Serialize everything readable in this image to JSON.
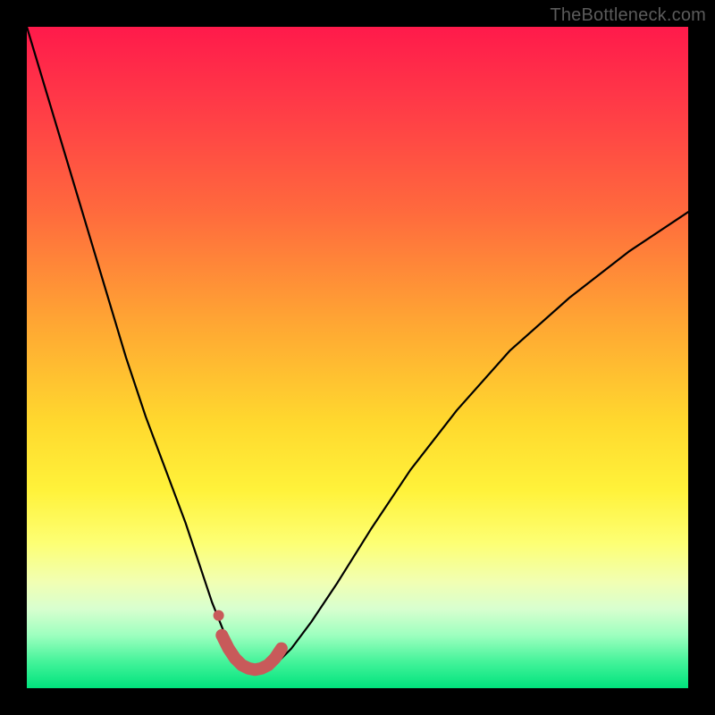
{
  "watermark": "TheBottleneck.com",
  "colors": {
    "frame": "#000000",
    "curve": "#000000",
    "highlight": "#c85a5a",
    "gradient_top": "#ff1a4b",
    "gradient_bottom": "#00e37d"
  },
  "chart_data": {
    "type": "line",
    "title": "",
    "xlabel": "",
    "ylabel": "",
    "xlim": [
      0,
      100
    ],
    "ylim": [
      0,
      100
    ],
    "grid": false,
    "legend": false,
    "note": "No numeric axis ticks are shown; values are estimated normalized percentages (0=bottom/left, 100=top/right).",
    "series": [
      {
        "name": "bottleneck-curve",
        "x": [
          0,
          3,
          6,
          9,
          12,
          15,
          18,
          21,
          24,
          26,
          28,
          30,
          31,
          32,
          33,
          34,
          35,
          36,
          38,
          40,
          43,
          47,
          52,
          58,
          65,
          73,
          82,
          91,
          100
        ],
        "y": [
          100,
          90,
          80,
          70,
          60,
          50,
          41,
          33,
          25,
          19,
          13,
          8,
          6,
          4,
          3,
          2.5,
          2.5,
          3,
          4,
          6,
          10,
          16,
          24,
          33,
          42,
          51,
          59,
          66,
          72
        ]
      }
    ],
    "highlight": {
      "name": "optimal-range",
      "x": [
        29.5,
        30.5,
        31.5,
        32.5,
        33.5,
        34.5,
        35.5,
        36.5,
        37.5,
        38.5
      ],
      "y": [
        8,
        6,
        4.5,
        3.5,
        3,
        2.8,
        3,
        3.5,
        4.5,
        6
      ],
      "marker_dot": {
        "x": 29,
        "y": 11
      }
    }
  }
}
